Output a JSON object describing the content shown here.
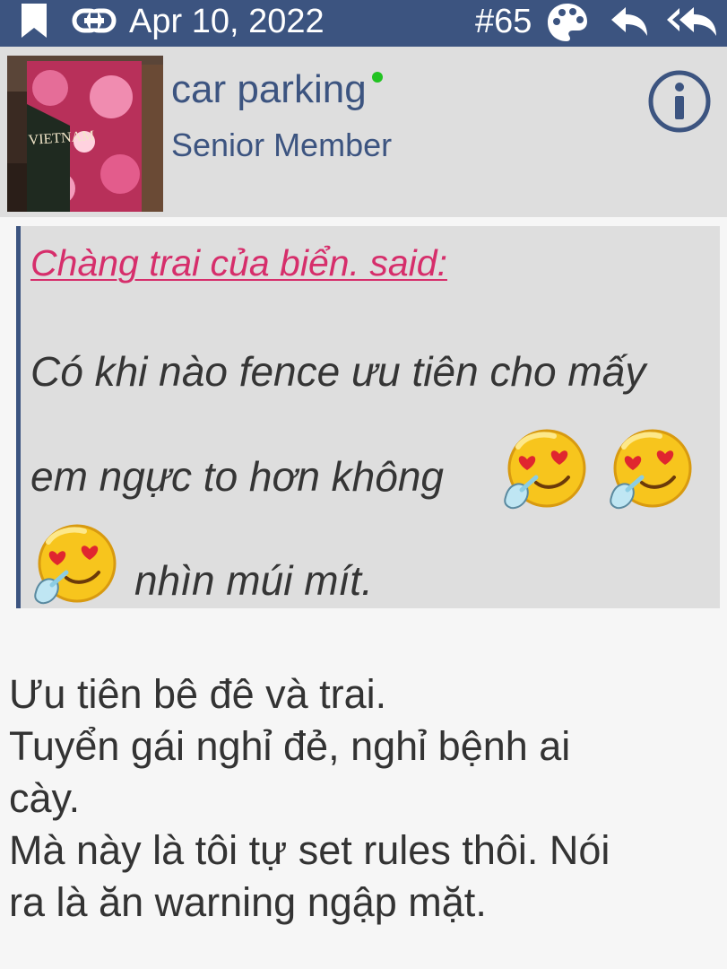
{
  "topbar": {
    "date": "Apr 10, 2022",
    "post_number": "#65",
    "icons": [
      "bookmark-icon",
      "link-icon",
      "palette-icon",
      "reply-icon",
      "reply-all-icon"
    ],
    "background": "#3c5480"
  },
  "user": {
    "name": "car parking",
    "title": "Senior Member",
    "online": true,
    "avatar_text": "VIETNAM"
  },
  "quote": {
    "author": "Chàng trai của biển. said:",
    "lines": [
      "Có khi nào fence ưu tiên cho mấy",
      "em ngực to hơn không",
      "nhìn múi mít."
    ],
    "emoji": "heart-eyes-drooling-emoji"
  },
  "post": {
    "lines": [
      "Ưu tiên bê đê và trai.",
      "Tuyển gái nghỉ đẻ, nghỉ bệnh ai",
      "cày.",
      "Mà này là tôi tự set rules thôi. Nói",
      "ra là ăn warning ngập mặt."
    ]
  },
  "colors": {
    "accent": "#3c5480",
    "quote_author": "#d62e6b",
    "online": "#22c322",
    "header_bg": "#dedede"
  }
}
